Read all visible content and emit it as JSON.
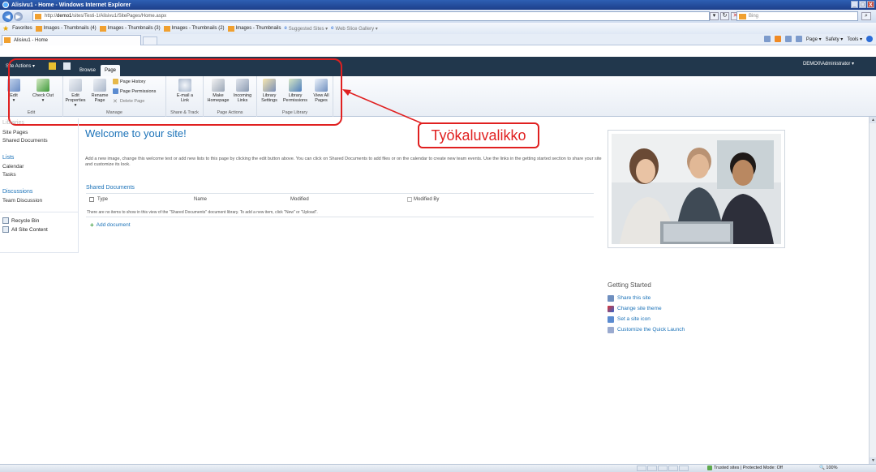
{
  "window": {
    "title": "Alisivu1 - Home - Windows Internet Explorer",
    "controls": [
      "_",
      "□",
      "X"
    ]
  },
  "address": {
    "prefix": "http://",
    "host": "demo1",
    "path": "/sites/Testi-1/Alisivu1/SitePages/Home.aspx"
  },
  "search": {
    "placeholder": "Bing"
  },
  "favorites": {
    "label": "Favorites",
    "items": [
      "Images - Thumbnails (4)",
      "Images - Thumbnails (3)",
      "Images - Thumbnails (2)",
      "Images - Thumbnails",
      "Suggested Sites ▾",
      "Web Slice Gallery ▾"
    ]
  },
  "tab": {
    "title": "Alisivu1 - Home"
  },
  "commandbar": {
    "page": "Page ▾",
    "safety": "Safety ▾",
    "tools": "Tools ▾"
  },
  "sharepoint": {
    "site_actions": "Site Actions ▾",
    "tabs": [
      "Browse",
      "Page"
    ],
    "user": "DEMO0\\Administrator ▾"
  },
  "ribbon": {
    "groups": {
      "edit": "Edit",
      "manage": "Manage",
      "share": "Share & Track",
      "actions": "Page Actions",
      "library": "Page Library"
    },
    "buttons": {
      "edit": "Edit",
      "checkout": "Check Out",
      "properties": "Edit Properties ▾",
      "rename": "Rename Page",
      "history": "Page History",
      "permissions": "Page Permissions",
      "delete": "Delete Page",
      "email": "E-mail a Link",
      "homepage": "Make Homepage",
      "incoming": "Incoming Links",
      "libsettings": "Library Settings",
      "libperms": "Library Permissions",
      "viewall": "View All Pages"
    }
  },
  "annotation": {
    "label": "Työkaluvalikko"
  },
  "quicklaunch": {
    "libraries_head": "Libraries",
    "libraries": [
      "Site Pages",
      "Shared Documents"
    ],
    "lists_head": "Lists",
    "lists": [
      "Calendar",
      "Tasks"
    ],
    "discussions_head": "Discussions",
    "discussions": [
      "Team Discussion"
    ],
    "recycle": "Recycle Bin",
    "all_content": "All Site Content"
  },
  "main": {
    "title": "Welcome to your site!",
    "intro": "Add a new image, change this welcome text or add new lists to this page by clicking the edit button above. You can click on Shared Documents to add files or on the calendar to create new team events. Use the links in the getting started section to share your site and customize its look.",
    "shared_docs": {
      "title": "Shared Documents",
      "columns": [
        "Type",
        "Name",
        "Modified",
        "Modified By"
      ],
      "empty": "There are no items to show in this view of the \"Shared Documents\" document library. To add a new item, click \"New\" or \"Upload\".",
      "add": "Add document"
    }
  },
  "getting_started": {
    "title": "Getting Started",
    "links": [
      "Share this site",
      "Change site theme",
      "Set a site icon",
      "Customize the Quick Launch"
    ]
  },
  "status": {
    "zone": "Trusted sites | Protected Mode: Off",
    "zoom": "100%"
  }
}
